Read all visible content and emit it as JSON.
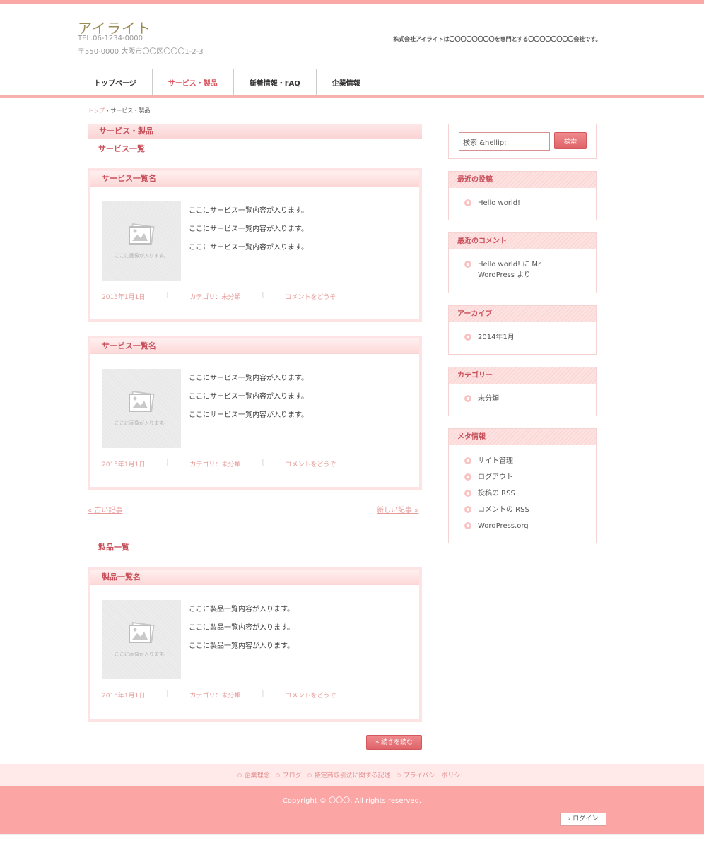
{
  "header": {
    "site_title": "アイライト",
    "tel": "TEL.06-1234-0000",
    "address": "〒550-0000 大阪市〇〇区〇〇〇1-2-3",
    "tagline": "株式会社アイライトは〇〇〇〇〇〇〇〇を専門とする〇〇〇〇〇〇〇〇会社です。"
  },
  "nav": {
    "items": [
      {
        "label": "トップページ"
      },
      {
        "label": "サービス・製品",
        "active": true
      },
      {
        "label": "新着情報・FAQ"
      },
      {
        "label": "企業情報"
      }
    ]
  },
  "breadcrumb": {
    "home": "トップ",
    "separator": " › ",
    "current": "サービス・製品"
  },
  "main": {
    "section_title": "サービス・製品",
    "service_heading": "サービス一覧",
    "product_heading": "製品一覧",
    "thumb_caption": "ここに画像が入ります。",
    "service_cards": [
      {
        "title": "サービス一覧名",
        "lines": [
          "ここにサービス一覧内容が入ります。",
          "ここにサービス一覧内容が入ります。",
          "ここにサービス一覧内容が入ります。"
        ],
        "date": "2015年1月1日",
        "category": "カテゴリ：未分類",
        "comment": "コメントをどうぞ"
      },
      {
        "title": "サービス一覧名",
        "lines": [
          "ここにサービス一覧内容が入ります。",
          "ここにサービス一覧内容が入ります。",
          "ここにサービス一覧内容が入ります。"
        ],
        "date": "2015年1月1日",
        "category": "カテゴリ：未分類",
        "comment": "コメントをどうぞ"
      }
    ],
    "pager": {
      "older": "« 古い記事",
      "newer": "新しい記事 »"
    },
    "product_cards": [
      {
        "title": "製品一覧名",
        "lines": [
          "ここに製品一覧内容が入ります。",
          "ここに製品一覧内容が入ります。",
          "ここに製品一覧内容が入ります。"
        ],
        "date": "2015年1月1日",
        "category": "カテゴリ：未分類",
        "comment": "コメントをどうぞ"
      }
    ],
    "more_button": "» 続きを読む"
  },
  "sidebar": {
    "search": {
      "value": "検索 &hellip;",
      "button": "検索"
    },
    "recent_posts": {
      "title": "最近の投稿",
      "items": [
        "Hello world!"
      ]
    },
    "recent_comments": {
      "title": "最近のコメント",
      "items": [
        "Hello world! に Mr WordPress より"
      ]
    },
    "archives": {
      "title": "アーカイブ",
      "items": [
        "2014年1月"
      ]
    },
    "categories": {
      "title": "カテゴリー",
      "items": [
        "未分類"
      ]
    },
    "meta": {
      "title": "メタ情報",
      "items": [
        "サイト管理",
        "ログアウト",
        "投稿の RSS",
        "コメントの RSS",
        "WordPress.org"
      ]
    }
  },
  "footer": {
    "links": [
      "企業理念",
      "ブログ",
      "特定商取引法に関する記述",
      "プライバシーポリシー"
    ],
    "copyright": "Copyright © 〇〇〇, All rights reserved.",
    "login": "› ログイン"
  },
  "colors": {
    "accent": "#fca5a5",
    "heading": "#c8505a",
    "link": "#e69a98"
  }
}
